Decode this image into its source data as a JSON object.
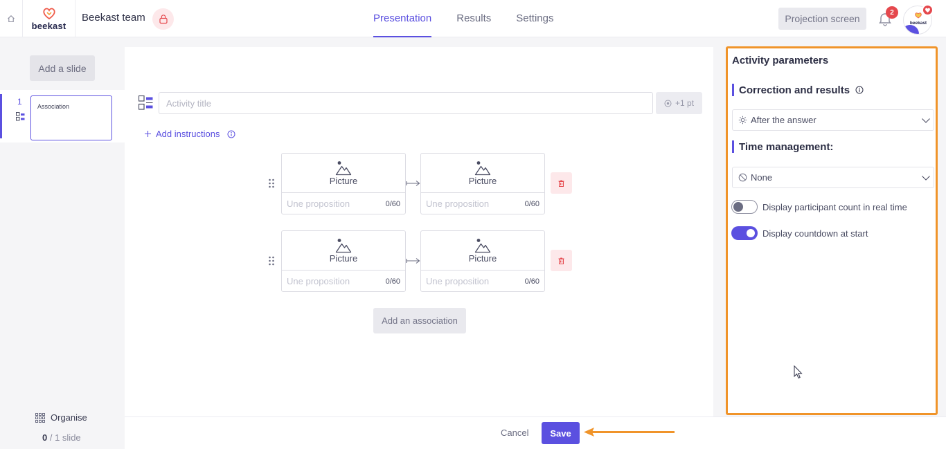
{
  "header": {
    "logo_text": "beekast",
    "team_name": "Beekast team",
    "tabs": [
      {
        "label": "Presentation",
        "active": true
      },
      {
        "label": "Results",
        "active": false
      },
      {
        "label": "Settings",
        "active": false
      }
    ],
    "projection_button": "Projection screen",
    "notification_count": "2",
    "avatar_text": "beekast"
  },
  "sidebar": {
    "add_slide_label": "Add a slide",
    "slides": [
      {
        "number": "1",
        "title": "Association"
      }
    ],
    "organise_label": "Organise",
    "count_current": "0",
    "count_rest": " / 1 slide"
  },
  "editor": {
    "title_placeholder": "Activity title",
    "title_value": "",
    "points_label": "+1 pt",
    "add_instructions_label": "Add instructions",
    "associations": [
      {
        "left": {
          "picture_label": "Picture",
          "placeholder": "Une proposition",
          "counter": "0/60"
        },
        "right": {
          "picture_label": "Picture",
          "placeholder": "Une proposition",
          "counter": "0/60"
        }
      },
      {
        "left": {
          "picture_label": "Picture",
          "placeholder": "Une proposition",
          "counter": "0/60"
        },
        "right": {
          "picture_label": "Picture",
          "placeholder": "Une proposition",
          "counter": "0/60"
        }
      }
    ],
    "add_association_label": "Add an association"
  },
  "panel": {
    "title": "Activity parameters",
    "correction_heading": "Correction and results",
    "correction_value": "After the answer",
    "time_heading": "Time management:",
    "time_value": "None",
    "toggles": [
      {
        "label": "Display participant count in real time",
        "on": false
      },
      {
        "label": "Display countdown at start",
        "on": true
      }
    ]
  },
  "footer": {
    "cancel_label": "Cancel",
    "save_label": "Save"
  },
  "colors": {
    "accent": "#5b50e0",
    "highlight_border": "#f0942a",
    "danger_bg": "#fde8ea",
    "danger": "#e5484d"
  },
  "icons": [
    "home-icon",
    "beekast-logo-icon",
    "lock-icon",
    "bell-icon",
    "activity-type-icon",
    "target-icon",
    "plus-icon",
    "info-icon",
    "image-icon",
    "drag-handle-icon",
    "link-arrow-icon",
    "trash-icon",
    "chevron-down-icon",
    "sun-icon",
    "ban-icon",
    "grid-icon",
    "cursor-icon"
  ]
}
